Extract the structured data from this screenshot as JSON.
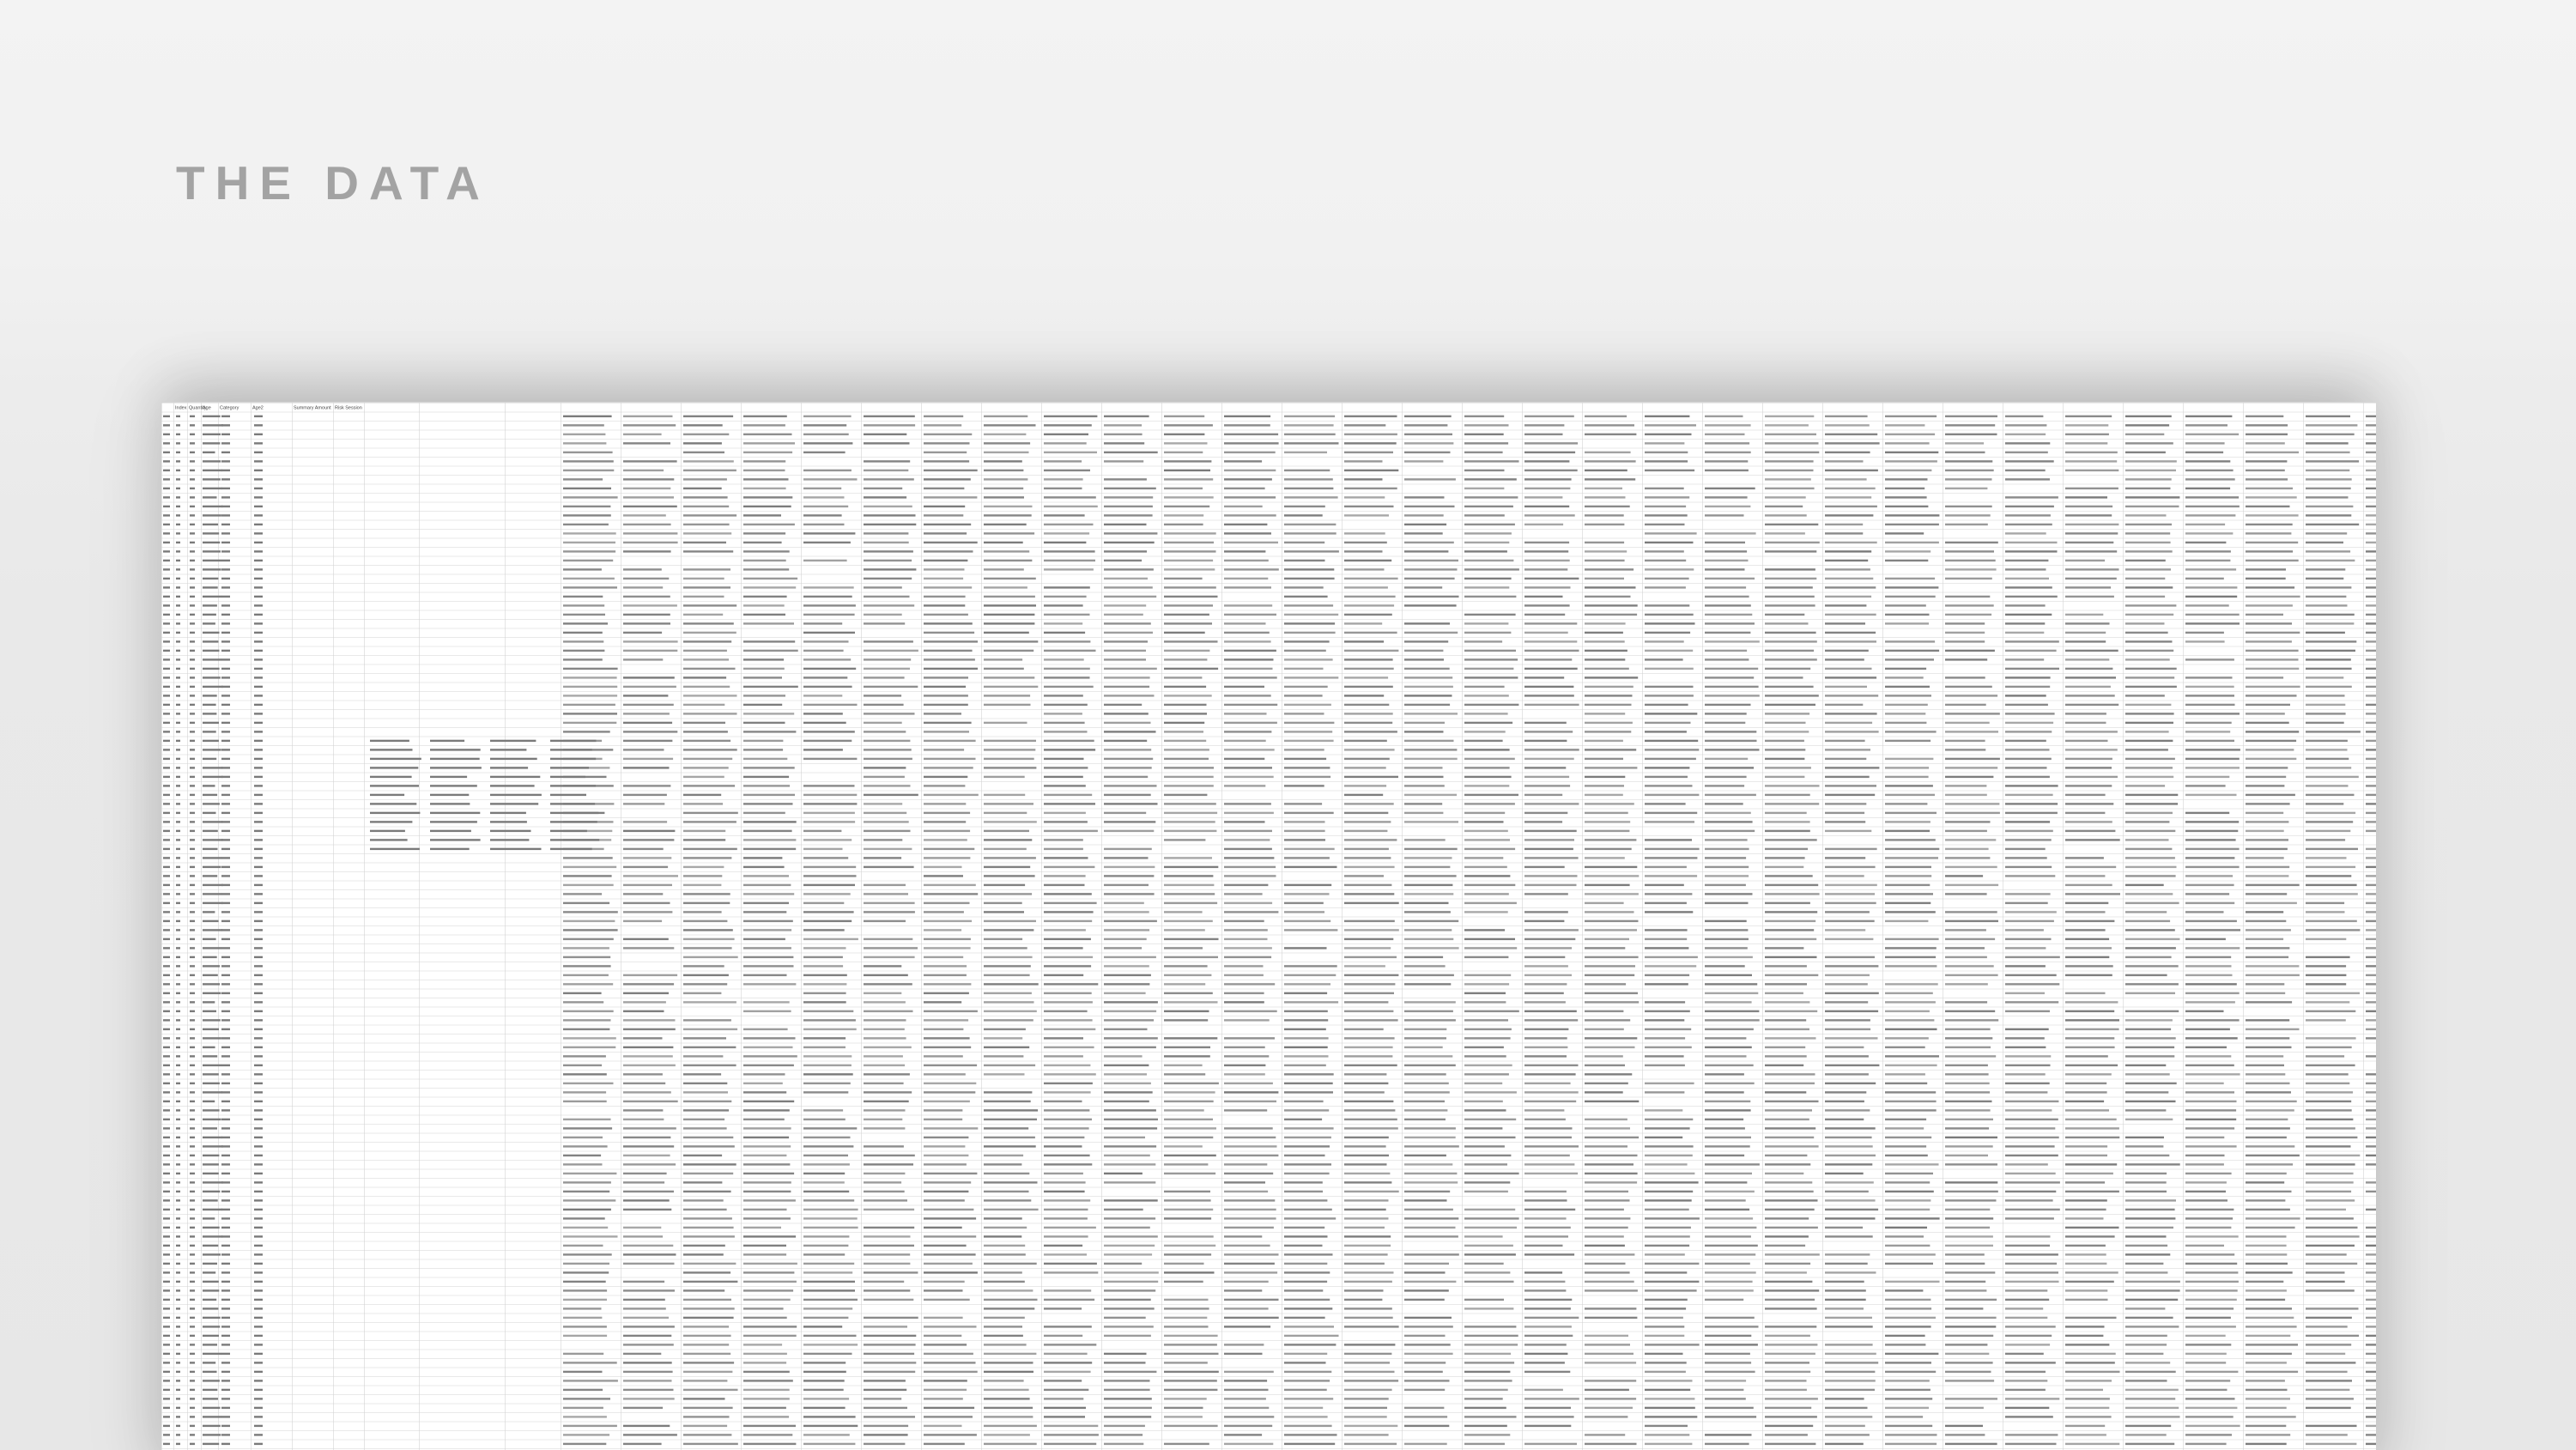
{
  "slide": {
    "title": "THE DATA"
  },
  "spreadsheet": {
    "columns": [
      "Index",
      "Quantity",
      "Age",
      "Category",
      "Age2",
      "Summary Amount",
      "Risk Session"
    ],
    "category_samples": [
      "Income",
      "Payment",
      "Consumption",
      "Utility"
    ],
    "region_samples": [
      "USA",
      "Asia",
      "Key",
      "EUR"
    ],
    "colors": {
      "grid": "#d4d4d4",
      "cell_text": "#7a7a7a",
      "header_text": "#444444"
    }
  }
}
